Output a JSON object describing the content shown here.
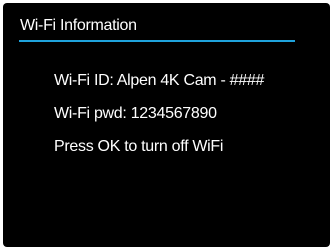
{
  "screen": {
    "title": "Wi-Fi Information",
    "accent_color": "#1fa3dc",
    "background_color": "#000000",
    "text_color": "#ffffff"
  },
  "info": {
    "wifi_id": "Wi-Fi ID: Alpen 4K Cam - ####",
    "wifi_pwd": "Wi-Fi pwd: 1234567890",
    "instruction": "Press OK to turn off WiFi"
  }
}
